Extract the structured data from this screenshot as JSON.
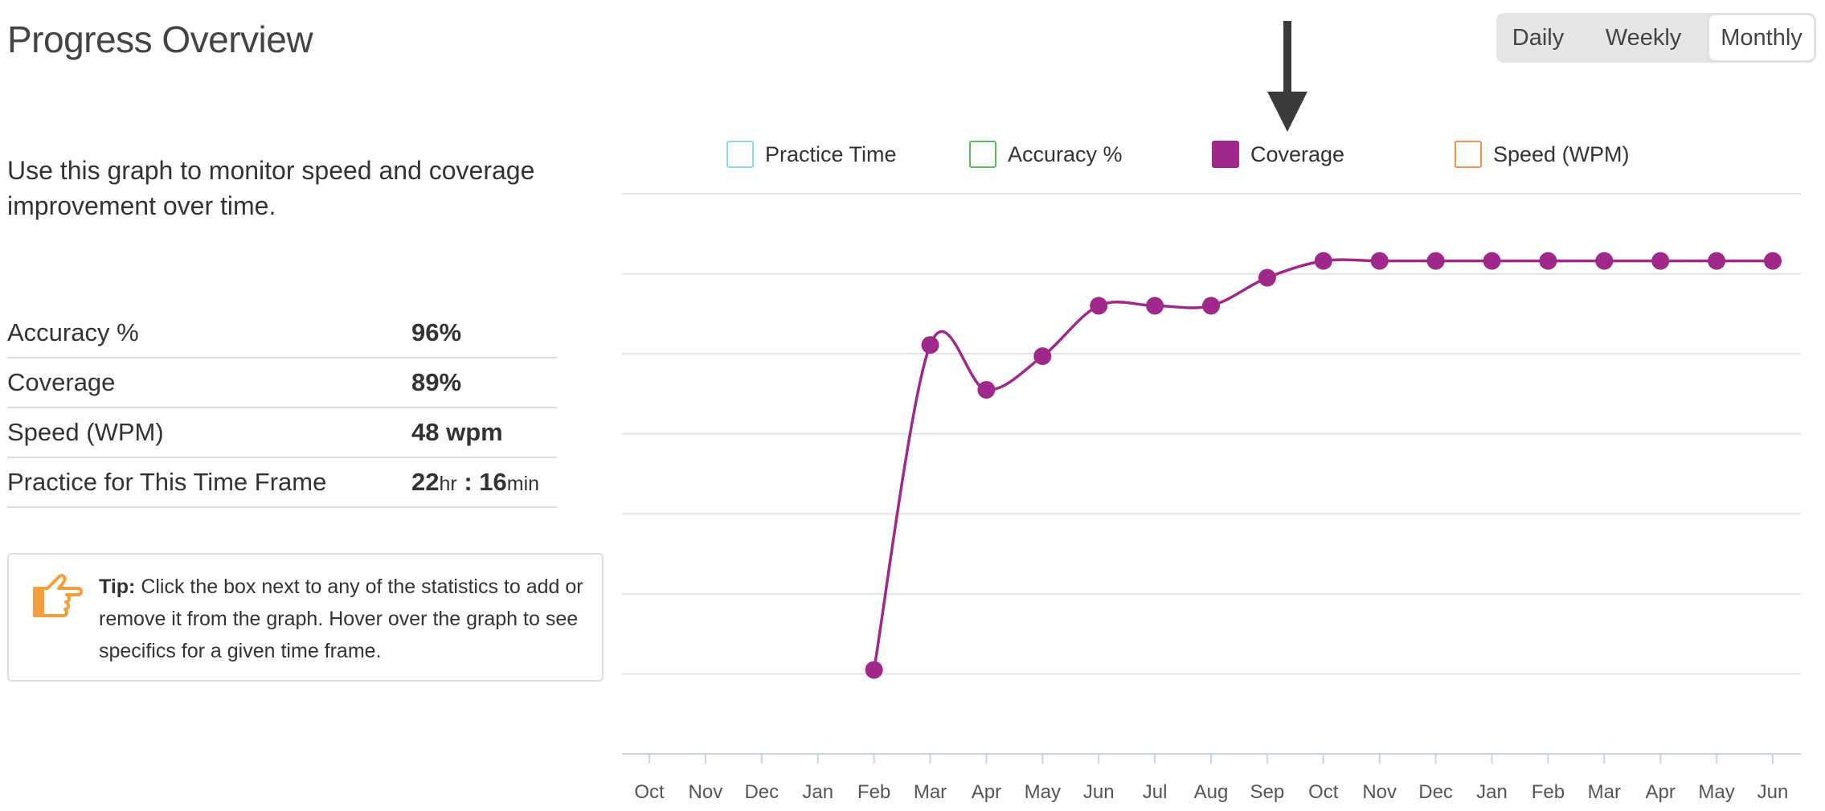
{
  "title": "Progress Overview",
  "period_tabs": [
    "Daily",
    "Weekly",
    "Monthly"
  ],
  "selected_period": "Monthly",
  "description": "Use this graph to monitor speed and coverage improvement over time.",
  "stats": {
    "accuracy": {
      "label": "Accuracy %",
      "value": "96%"
    },
    "coverage": {
      "label": "Coverage",
      "value": "89%"
    },
    "speed": {
      "label": "Speed (WPM)",
      "value": "48 wpm"
    },
    "practice": {
      "label": "Practice for This Time Frame",
      "hours": "22",
      "hr_unit": "hr",
      "sep": " : ",
      "minutes": "16",
      "min_unit": "min"
    }
  },
  "tip": {
    "label": "Tip:",
    "text": " Click the box next to any of the statistics to add or remove it from the graph. Hover over the graph to see specifics for a given time frame."
  },
  "legend": [
    {
      "name": "Practice Time",
      "color": "#8fd8ee",
      "checked": false
    },
    {
      "name": "Accuracy %",
      "color": "#5cb85c",
      "checked": false
    },
    {
      "name": "Coverage",
      "color": "#a0288a",
      "checked": true
    },
    {
      "name": "Speed (WPM)",
      "color": "#f0924a",
      "checked": false
    }
  ],
  "chart_data": {
    "type": "line",
    "x": [
      "Oct",
      "Nov",
      "Dec",
      "Jan",
      "Feb",
      "Mar",
      "Apr",
      "May",
      "Jun",
      "Jul",
      "Aug",
      "Sep",
      "Oct",
      "Nov",
      "Dec",
      "Jan",
      "Feb",
      "Mar",
      "Apr",
      "May",
      "Jun"
    ],
    "series": [
      {
        "name": "Coverage",
        "color": "#a0288a",
        "values": [
          null,
          null,
          null,
          null,
          15,
          73,
          65,
          71,
          80,
          80,
          80,
          85,
          88,
          88,
          88,
          88,
          88,
          88,
          88,
          88,
          88
        ]
      }
    ],
    "ylim": [
      0,
      100
    ],
    "grid": true,
    "legend_position": "top"
  }
}
